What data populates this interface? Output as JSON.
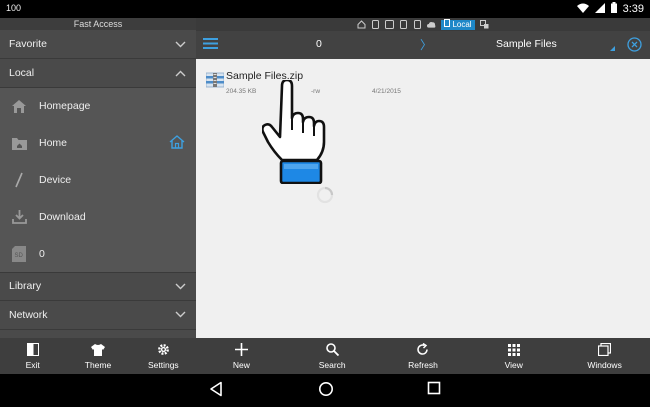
{
  "status_bar": {
    "left_text": "100",
    "time": "3:39"
  },
  "sidebar": {
    "fast_access_label": "Fast Access",
    "favorite_label": "Favorite",
    "local_label": "Local",
    "items": [
      {
        "label": "Homepage",
        "icon": "homepage-icon"
      },
      {
        "label": "Home",
        "icon": "home-folder-icon"
      },
      {
        "label": "Device",
        "icon": "device-slash-icon"
      },
      {
        "label": "Download",
        "icon": "download-icon"
      },
      {
        "label": "0",
        "icon": "sd-card-icon"
      }
    ],
    "library_label": "Library",
    "network_label": "Network"
  },
  "side_toolbar": [
    {
      "label": "Exit",
      "icon": "exit-icon"
    },
    {
      "label": "Theme",
      "icon": "shirt-icon"
    },
    {
      "label": "Settings",
      "icon": "gear-icon"
    }
  ],
  "tab_strip": {
    "local_chip": "Local"
  },
  "topbar": {
    "count": "0",
    "path_separator": "〉",
    "title": "Sample Files"
  },
  "files": [
    {
      "name": "Sample Files.zip",
      "size": "204.35 KB",
      "perm": "-rw",
      "date": "4/21/2015"
    }
  ],
  "main_toolbar": [
    {
      "label": "New",
      "icon": "plus-icon"
    },
    {
      "label": "Search",
      "icon": "search-icon"
    },
    {
      "label": "Refresh",
      "icon": "refresh-icon"
    },
    {
      "label": "View",
      "icon": "grid-view-icon"
    },
    {
      "label": "Windows",
      "icon": "windows-stack-icon"
    }
  ],
  "colors": {
    "accent": "#3ea0e0",
    "sidebar_bg": "#4a4a4a",
    "toolbar_bg": "#3e3e3e",
    "content_bg": "#f0f0f0"
  }
}
